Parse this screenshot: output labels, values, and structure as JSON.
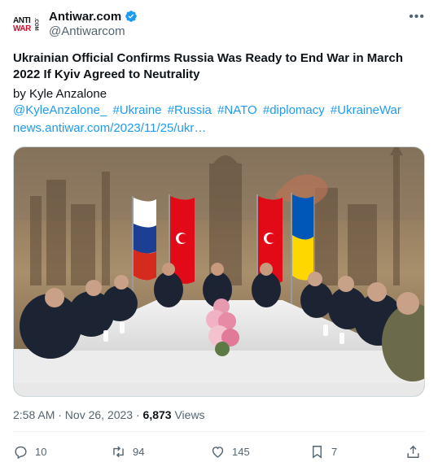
{
  "tweet": {
    "author_name": "Antiwar.com",
    "handle": "@Antiwarcom",
    "avatar_text": {
      "top": "ANTI",
      "bottom": "WAR",
      "side": ".COM"
    },
    "title": "Ukrainian Official Confirms Russia Was Ready to End War in March 2022 If Kyiv Agreed to Neutrality",
    "byline": "by Kyle Anzalone",
    "tags": [
      "@KyleAnzalone_",
      "#Ukraine",
      "#Russia",
      "#NATO",
      "#diplomacy",
      "#UkraineWar"
    ],
    "link": "news.antiwar.com/2023/11/25/ukr…",
    "time": "2:58 AM · Nov 26, 2023 · ",
    "views_count": "6,873",
    "views_label": " Views"
  },
  "actions": {
    "replies": "10",
    "reposts": "94",
    "likes": "145",
    "bookmarks": "7"
  },
  "colors": {
    "accent": "#1d9bf0",
    "muted": "#536471",
    "text": "#0f1419"
  },
  "icons": [
    "verified-badge-icon",
    "more-icon",
    "reply-icon",
    "repost-icon",
    "like-icon",
    "bookmark-icon",
    "share-icon"
  ]
}
